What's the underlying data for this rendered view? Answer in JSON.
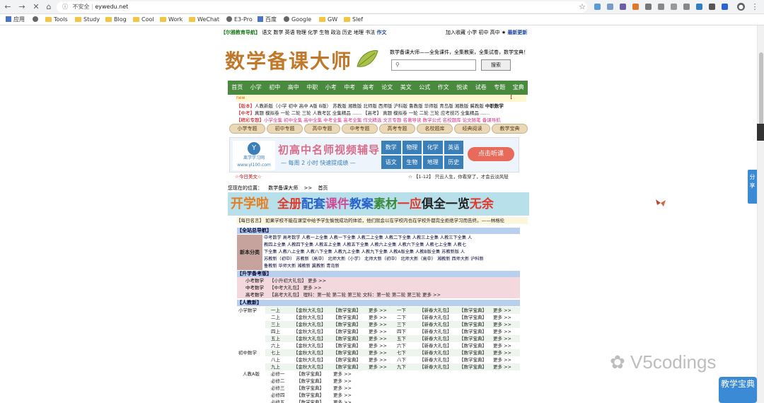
{
  "browser": {
    "insecure_label": "不安全",
    "url": "eywedu.net",
    "bookmarks": [
      {
        "label": "应用",
        "kind": "grid"
      },
      {
        "label": "",
        "kind": "globe"
      },
      {
        "label": "Tools",
        "kind": "folder"
      },
      {
        "label": "Study",
        "kind": "folder"
      },
      {
        "label": "Blog",
        "kind": "folder"
      },
      {
        "label": "Cool",
        "kind": "folder"
      },
      {
        "label": "Work",
        "kind": "folder"
      },
      {
        "label": "WeChat",
        "kind": "folder"
      },
      {
        "label": "E3-Pro",
        "kind": "globe"
      },
      {
        "label": "百度",
        "kind": "grid"
      },
      {
        "label": "Google",
        "kind": "globe"
      },
      {
        "label": "GW",
        "kind": "folder"
      },
      {
        "label": "Slef",
        "kind": "folder"
      }
    ]
  },
  "topline": {
    "brand": "【尔雅教育导航】",
    "subjects": "语文  数学  英语  物理  化学  生物  政治  历史  地理  书法",
    "composition": "作文",
    "right_links": "加入收藏  小学  初中  高中",
    "latest": "最新更新"
  },
  "header": {
    "logo": "数学备课大师",
    "slogan": "数学备课大师——全免课件，全集教案，全集试卷，数学宝典！",
    "search_placeholder": "",
    "search_button": "搜索"
  },
  "mainnav": [
    "首页",
    "小学",
    "初中",
    "高中",
    "中职",
    "小考",
    "中考",
    "高考",
    "论文",
    "美文",
    "公式",
    "作文",
    "悦读",
    "试卷",
    "专题",
    "宝典"
  ],
  "subbar": {
    "left": "new",
    "right": "【"
  },
  "links": [
    {
      "a": "【版本】",
      "b": "人教新版（小学 初中 高中 A版 B版） 苏教版 湘教版 北师版 西师版 沪科版 鲁教版 华师版 青岛版 湘教版 冀教版",
      "c": "中职数学"
    },
    {
      "a": "【中考】",
      "b": "真题 模拟卷 一轮 二轮 三轮 人教考区 全集精品 ……",
      "c": "【高考】 真题 模拟卷 一轮 二轮 三轮 应考技巧 全集精品 ……"
    },
    {
      "a": "【精彩专题】",
      "b": "小学全集 初中全集 高中全集 中考全集 高考全集 作文精选 文言专题 名著导读 数学公式 名校题库 论文随笔",
      "c": "备课导航"
    }
  ],
  "pills": [
    "小学专题",
    "初中专题",
    "高中专题",
    "中考专题",
    "高考专题",
    "名校题库",
    "经典阅读",
    "教学宝典"
  ],
  "ad": {
    "logo_char": "Y",
    "logo_name": "离学学习网",
    "logo_url": "www.yl100.com",
    "title": "初高中名师视频辅导",
    "subtitle": "— 每周 2 小时  快速提成绩 —",
    "subjects": [
      "数学",
      "物理",
      "化学",
      "英语",
      "语文",
      "生物",
      "地理",
      "历史"
    ],
    "button": "点击听课"
  },
  "under_banner": {
    "left": "☆今日美文☆",
    "right": "☆ 【1-12】 只云人生，你看穿了，才会云淡风轻"
  },
  "breadcrumb": {
    "prefix": "您现在的位置：",
    "site": "数学备课大师",
    "sep": ">>",
    "page": "首页"
  },
  "big_banner": {
    "badge": "开学啦",
    "text": "全册配套课件教案素材一应俱全一览无余"
  },
  "tip": "【每日名言】 如果学校不能在课堂中给予学生愉悦成功的体验，他们就会以在学校内也在学校外都完全拒绝学习而告终。——林格伦",
  "nav_section": {
    "title": "【全站总导航】",
    "label": "新本分类",
    "text": [
      "中考数学  高考数学  人教一上全集  人教一下全集  人教二上全集  人教二下全集  人教三上全集  人教三下全集  人",
      "教四上全集  人教四下全集  人教五上全集  人教五下全集  人教六上全集  人教六下全集  人教七上全集  人教七",
      "下全集  人教八上全集  人教八下全集  人教九上全集  人教九下全集  人教A版全集  人教B版全集  苏教新版  人",
      "苏教新（初中）  苏教新（高中）  北师大新（小学）  北师大新（初中）  北师大新（高中）  湘教新  西师大新  沪科新",
      "鲁教新  华师大新  湘教新  冀教新  青岛新"
    ]
  },
  "shengxue": {
    "title": "【升学备考版】",
    "rows": [
      {
        "k": "小考数学",
        "v": "【小升初大礼包】 更多 >>"
      },
      {
        "k": "中考数学",
        "v": "【中考大礼包】 更多 >>"
      },
      {
        "k": "高考数学",
        "v": "【高考大礼包】 理科：第一轮  第二轮  第三轮  文科：第一轮  第二轮  第三轮  更多 >>"
      }
    ]
  },
  "renjiao": {
    "title": "【人教新】",
    "group1": "小学数学",
    "group2": "初中数学",
    "left_gift": "【金秋大礼包】",
    "right_gift": "【新春大礼包】",
    "book": "【数学宝典】",
    "more": "更多 >>",
    "left": [
      "一上",
      "二上",
      "三上",
      "四上",
      "五上",
      "六上",
      "七上",
      "八上",
      "九上"
    ],
    "right": [
      "一下",
      "二下",
      "三下",
      "四下",
      "五下",
      "六下",
      "七下",
      "八下",
      "九下"
    ]
  },
  "rabk": {
    "label": "人教A版",
    "items": [
      "必修一",
      "必修二",
      "必修三",
      "必修四",
      "必修五"
    ],
    "book": "【数学宝典】",
    "more": "更多 >>"
  },
  "share_tab": "分享",
  "fav_button": "教学宝典",
  "watermark": "V5codings"
}
